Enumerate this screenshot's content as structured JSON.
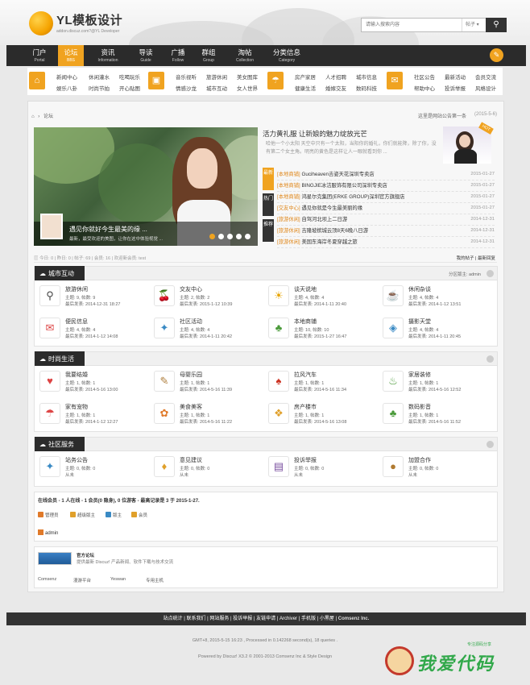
{
  "header": {
    "logo_text": "YL模板设计",
    "logo_sub": "addon.discuz.com?@YL Developer",
    "search_placeholder": "请输入搜索内容",
    "search_type": "帖子",
    "search_icon": "search-icon"
  },
  "nav": {
    "items": [
      {
        "cn": "门户",
        "en": "Portal"
      },
      {
        "cn": "论坛",
        "en": "BBS"
      },
      {
        "cn": "资讯",
        "en": "Information"
      },
      {
        "cn": "导读",
        "en": "Guide"
      },
      {
        "cn": "广播",
        "en": "Follow"
      },
      {
        "cn": "群组",
        "en": "Group"
      },
      {
        "cn": "淘帖",
        "en": "Collection"
      },
      {
        "cn": "分类信息",
        "en": "Category"
      }
    ],
    "accent": "#f0a320"
  },
  "subnav": {
    "blocks": [
      {
        "icon": "home-icon",
        "links": [
          "新闻中心",
          "休闲灌水",
          "吃喝玩乐",
          "娱乐八卦",
          "时尚节拍",
          "开心贴图"
        ]
      },
      {
        "icon": "image-icon",
        "links": [
          "音乐视听",
          "旅游休闲",
          "美女图库",
          "情感沙龙",
          "城市互动",
          "女人世界"
        ]
      },
      {
        "icon": "umbrella-icon",
        "links": [
          "房产家居",
          "人才招聘",
          "城市信息",
          "健康生活",
          "婚嫁交友",
          "数码科技"
        ]
      },
      {
        "icon": "megaphone-icon",
        "links": [
          "社区公告",
          "最新活动",
          "会员交流",
          "帮助中心",
          "投诉举报",
          "风格设计"
        ]
      }
    ]
  },
  "breadcrumb": {
    "home": "⌂",
    "current": "论坛",
    "notice": "这里是网站公告第一条",
    "notice_date": "(2015-5-6)"
  },
  "slider": {
    "caption": "遇见你就好今生最美的缘 ...",
    "desc": "最新，最受欢迎的美图，让你在这中体验视觉 ..."
  },
  "headline": {
    "title": "活力黄礼服 让新娘的魅力绽放光芒",
    "desc": "哈他一个小太阳 天空中只有一个太阳，当阳你的婚礼，你们就能降，除了你，没有第二个女主角。明亮的黄色是这样让人一眼就看到你 ...",
    "badge": "HOT"
  },
  "news_tabs": [
    "最新",
    "热门",
    "推荐"
  ],
  "news": [
    {
      "cat": "[本地商铺]",
      "title": "Guciheaven吉姿天花深圳专卖店",
      "date": "2015-01-27"
    },
    {
      "cat": "[本地商铺]",
      "title": "BINGJIE冰洁服饰有限公司深圳专卖店",
      "date": "2015-01-27"
    },
    {
      "cat": "[本地商铺]",
      "title": "鸿星尔克集团(ERKE GROUP)深圳官方旗舰店",
      "date": "2015-01-27"
    },
    {
      "cat": "[交友中心]",
      "title": "遇见你就是今生最美丽的缘",
      "date": "2015-01-27"
    },
    {
      "cat": "[旅游休闲]",
      "title": "自驾河北坝上二日游",
      "date": "2014-12-31"
    },
    {
      "cat": "[旅游休闲]",
      "title": "吉隆坡槟城云顶8天6晚八日游",
      "date": "2014-12-31"
    },
    {
      "cat": "[旅游休闲]",
      "title": "美国东海岸冬夏穿越之旅",
      "date": "2014-12-31"
    }
  ],
  "stats": {
    "text": "今日: 0 | 昨日: 0 | 帖子: 69 | 会员: 16 | 欢迎新会员: test",
    "right": "我的帖子 | 最新回复"
  },
  "sections": [
    {
      "title": "城市互动",
      "moderator": "分区版主: admin",
      "forums": [
        {
          "icon": "compass-icon",
          "glyph": "⚲",
          "name": "旅游休闲",
          "stat": "主题: 9, 帖数: 9",
          "last": "最后发表: 2014-12-31 18:27"
        },
        {
          "icon": "cherry-icon",
          "glyph": "🍒",
          "name": "交友中心",
          "stat": "主题: 2, 帖数: 2",
          "last": "最后发表: 2015-1-12 10:39"
        },
        {
          "icon": "sun-icon",
          "glyph": "☀",
          "name": "谈天说地",
          "stat": "主题: 4, 帖数: 4",
          "last": "最后发表: 2014-1-11 20:40"
        },
        {
          "icon": "coffee-icon",
          "glyph": "☕",
          "name": "休闲杂谈",
          "stat": "主题: 4, 帖数: 4",
          "last": "最后发表: 2014-1-12 13:51"
        },
        {
          "icon": "gift-icon",
          "glyph": "✉",
          "name": "便民信息",
          "stat": "主题: 4, 帖数: 4",
          "last": "最后发表: 2014-1-12 14:08"
        },
        {
          "icon": "wand-icon",
          "glyph": "✦",
          "name": "社区活动",
          "stat": "主题: 4, 帖数: 4",
          "last": "最后发表: 2014-1-11 20:42"
        },
        {
          "icon": "tree-icon",
          "glyph": "♣",
          "name": "本地商铺",
          "stat": "主题: 10, 帖数: 10",
          "last": "最后发表: 2015-1-27 16:47"
        },
        {
          "icon": "box-icon",
          "glyph": "◈",
          "name": "摄影天堂",
          "stat": "主题: 4, 帖数: 4",
          "last": "最后发表: 2014-1-11 20:45"
        }
      ]
    },
    {
      "title": "时尚生活",
      "moderator": "",
      "forums": [
        {
          "icon": "heart-wand-icon",
          "glyph": "♥",
          "name": "我要结婚",
          "stat": "主题: 1, 帖数: 1",
          "last": "最后发表: 2014-5-16 13:00"
        },
        {
          "icon": "book-icon",
          "glyph": "✎",
          "name": "母婴乐园",
          "stat": "主题: 1, 帖数: 1",
          "last": "最后发表: 2014-5-16 11:39"
        },
        {
          "icon": "tie-icon",
          "glyph": "♠",
          "name": "拉风汽车",
          "stat": "主题: 1, 帖数: 1",
          "last": "最后发表: 2014-5-16 11:34"
        },
        {
          "icon": "bottle-icon",
          "glyph": "♨",
          "name": "家居装修",
          "stat": "主题: 1, 帖数: 1",
          "last": "最后发表: 2014-5-16 12:52"
        },
        {
          "icon": "umbrella-icon",
          "glyph": "☂",
          "name": "家有宠物",
          "stat": "主题: 1, 帖数: 1",
          "last": "最后发表: 2014-1-12 12:27"
        },
        {
          "icon": "cake-icon",
          "glyph": "✿",
          "name": "美食美客",
          "stat": "主题: 1, 帖数: 1",
          "last": "最后发表: 2014-5-16 11:22"
        },
        {
          "icon": "gift-box-icon",
          "glyph": "❖",
          "name": "房产楼市",
          "stat": "主题: 1, 帖数: 1",
          "last": "最后发表: 2014-5-16 13:08"
        },
        {
          "icon": "tree-icon",
          "glyph": "♣",
          "name": "数码影音",
          "stat": "主题: 1, 帖数: 1",
          "last": "最后发表: 2014-5-16 11:52"
        }
      ]
    },
    {
      "title": "社区服务",
      "moderator": "",
      "forums": [
        {
          "icon": "wand-icon",
          "glyph": "✦",
          "name": "站务公告",
          "stat": "主题: 0, 帖数: 0",
          "last": "从未"
        },
        {
          "icon": "icecream-icon",
          "glyph": "♦",
          "name": "意见建议",
          "stat": "主题: 0, 帖数: 0",
          "last": "从未"
        },
        {
          "icon": "books-icon",
          "glyph": "▤",
          "name": "投诉举报",
          "stat": "主题: 0, 帖数: 0",
          "last": "从未"
        },
        {
          "icon": "coins-icon",
          "glyph": "●",
          "name": "加盟合作",
          "stat": "主题: 0, 帖数: 0",
          "last": "从未"
        }
      ]
    }
  ],
  "online": {
    "title": "在线会员 - 1 人在线 - 1 会员(0 隐身), 0 位游客 - 最高记录是 3 于 2015-1-27.",
    "legend": [
      {
        "label": "管理员",
        "color": "#e07a2a"
      },
      {
        "label": "超级版主",
        "color": "#e0a02a"
      },
      {
        "label": "版主",
        "color": "#3a8ac4"
      },
      {
        "label": "会员",
        "color": "#e0a02a"
      }
    ],
    "user": "admin"
  },
  "links": {
    "title": "官方论坛",
    "desc": "提供最新 Discuz! 产品新闻、软件下载与技术交流",
    "items": [
      "Comsenz",
      "漫游平台",
      "Yeswan",
      "专用主机"
    ]
  },
  "footer": {
    "links": "站点统计 | 联系我们 | 网站服务 | 投诉举报 | 友链申请 | Archiver | 手机版 | 小黑屋 |",
    "brand": " Comsenz Inc.",
    "info": "GMT+8, 2015-5-15 16:23 , Processed in 0.142268 second(s), 18 queries .",
    "copy": "Powered by Discuz! X3.2 © 2001-2013 Comsenz Inc & Style Design"
  },
  "watermark": {
    "text": "我爱代码",
    "small": "专注源码分享"
  }
}
